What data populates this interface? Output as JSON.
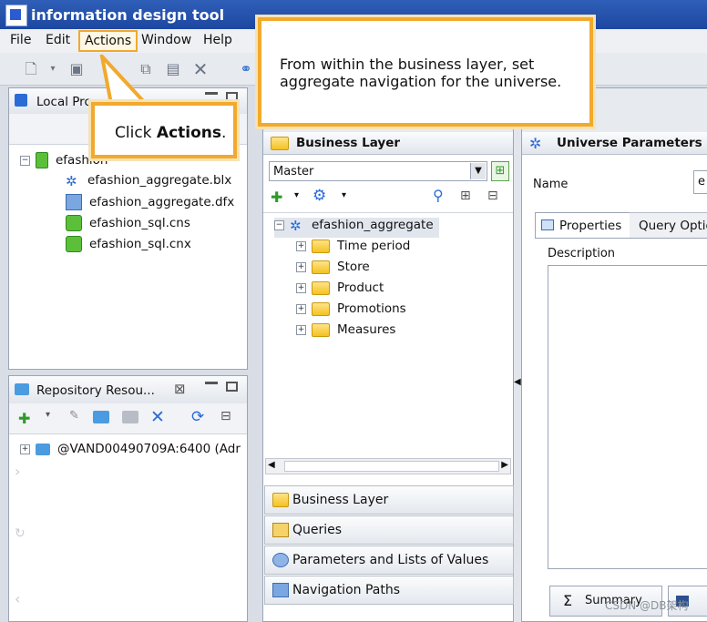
{
  "window": {
    "title": "information design tool"
  },
  "menu": [
    "File",
    "Edit",
    "Actions",
    "Window",
    "Help"
  ],
  "local_projects": {
    "title": "Local Pro",
    "root": "efashion",
    "files": [
      {
        "name": "efashion_aggregate.blx",
        "icon": "business-layer-icon"
      },
      {
        "name": "efashion_aggregate.dfx",
        "icon": "data-foundation-icon"
      },
      {
        "name": "efashion_sql.cns",
        "icon": "connection-shortcut-icon"
      },
      {
        "name": "efashion_sql.cnx",
        "icon": "connection-icon"
      }
    ]
  },
  "repository": {
    "title": "Repository Resou...",
    "server": "@VAND00490709A:6400 (Adr"
  },
  "business_layer": {
    "title": "Business Layer",
    "view_select": "Master",
    "root": "efashion_aggregate",
    "folders": [
      "Time period",
      "Store",
      "Product",
      "Promotions",
      "Measures"
    ]
  },
  "nav_sections": [
    "Business Layer",
    "Queries",
    "Parameters and Lists of Values",
    "Navigation Paths"
  ],
  "universe_params": {
    "title": "Universe Parameters",
    "name_label": "Name",
    "name_value": "e",
    "tabs": [
      "Properties",
      "Query Optio"
    ],
    "description_label": "Description",
    "summary_label": "Summary"
  },
  "callouts": {
    "click_actions_prefix": "Click ",
    "click_actions_bold": "Actions",
    "click_actions_suffix": ".",
    "instruction": "From within the business layer, set aggregate navigation for the universe."
  },
  "watermark": "CSDN @DB架构",
  "colors": {
    "accent": "#f1a92e",
    "titlebar": "#2f5fb8",
    "folder": "#f4c21f"
  }
}
